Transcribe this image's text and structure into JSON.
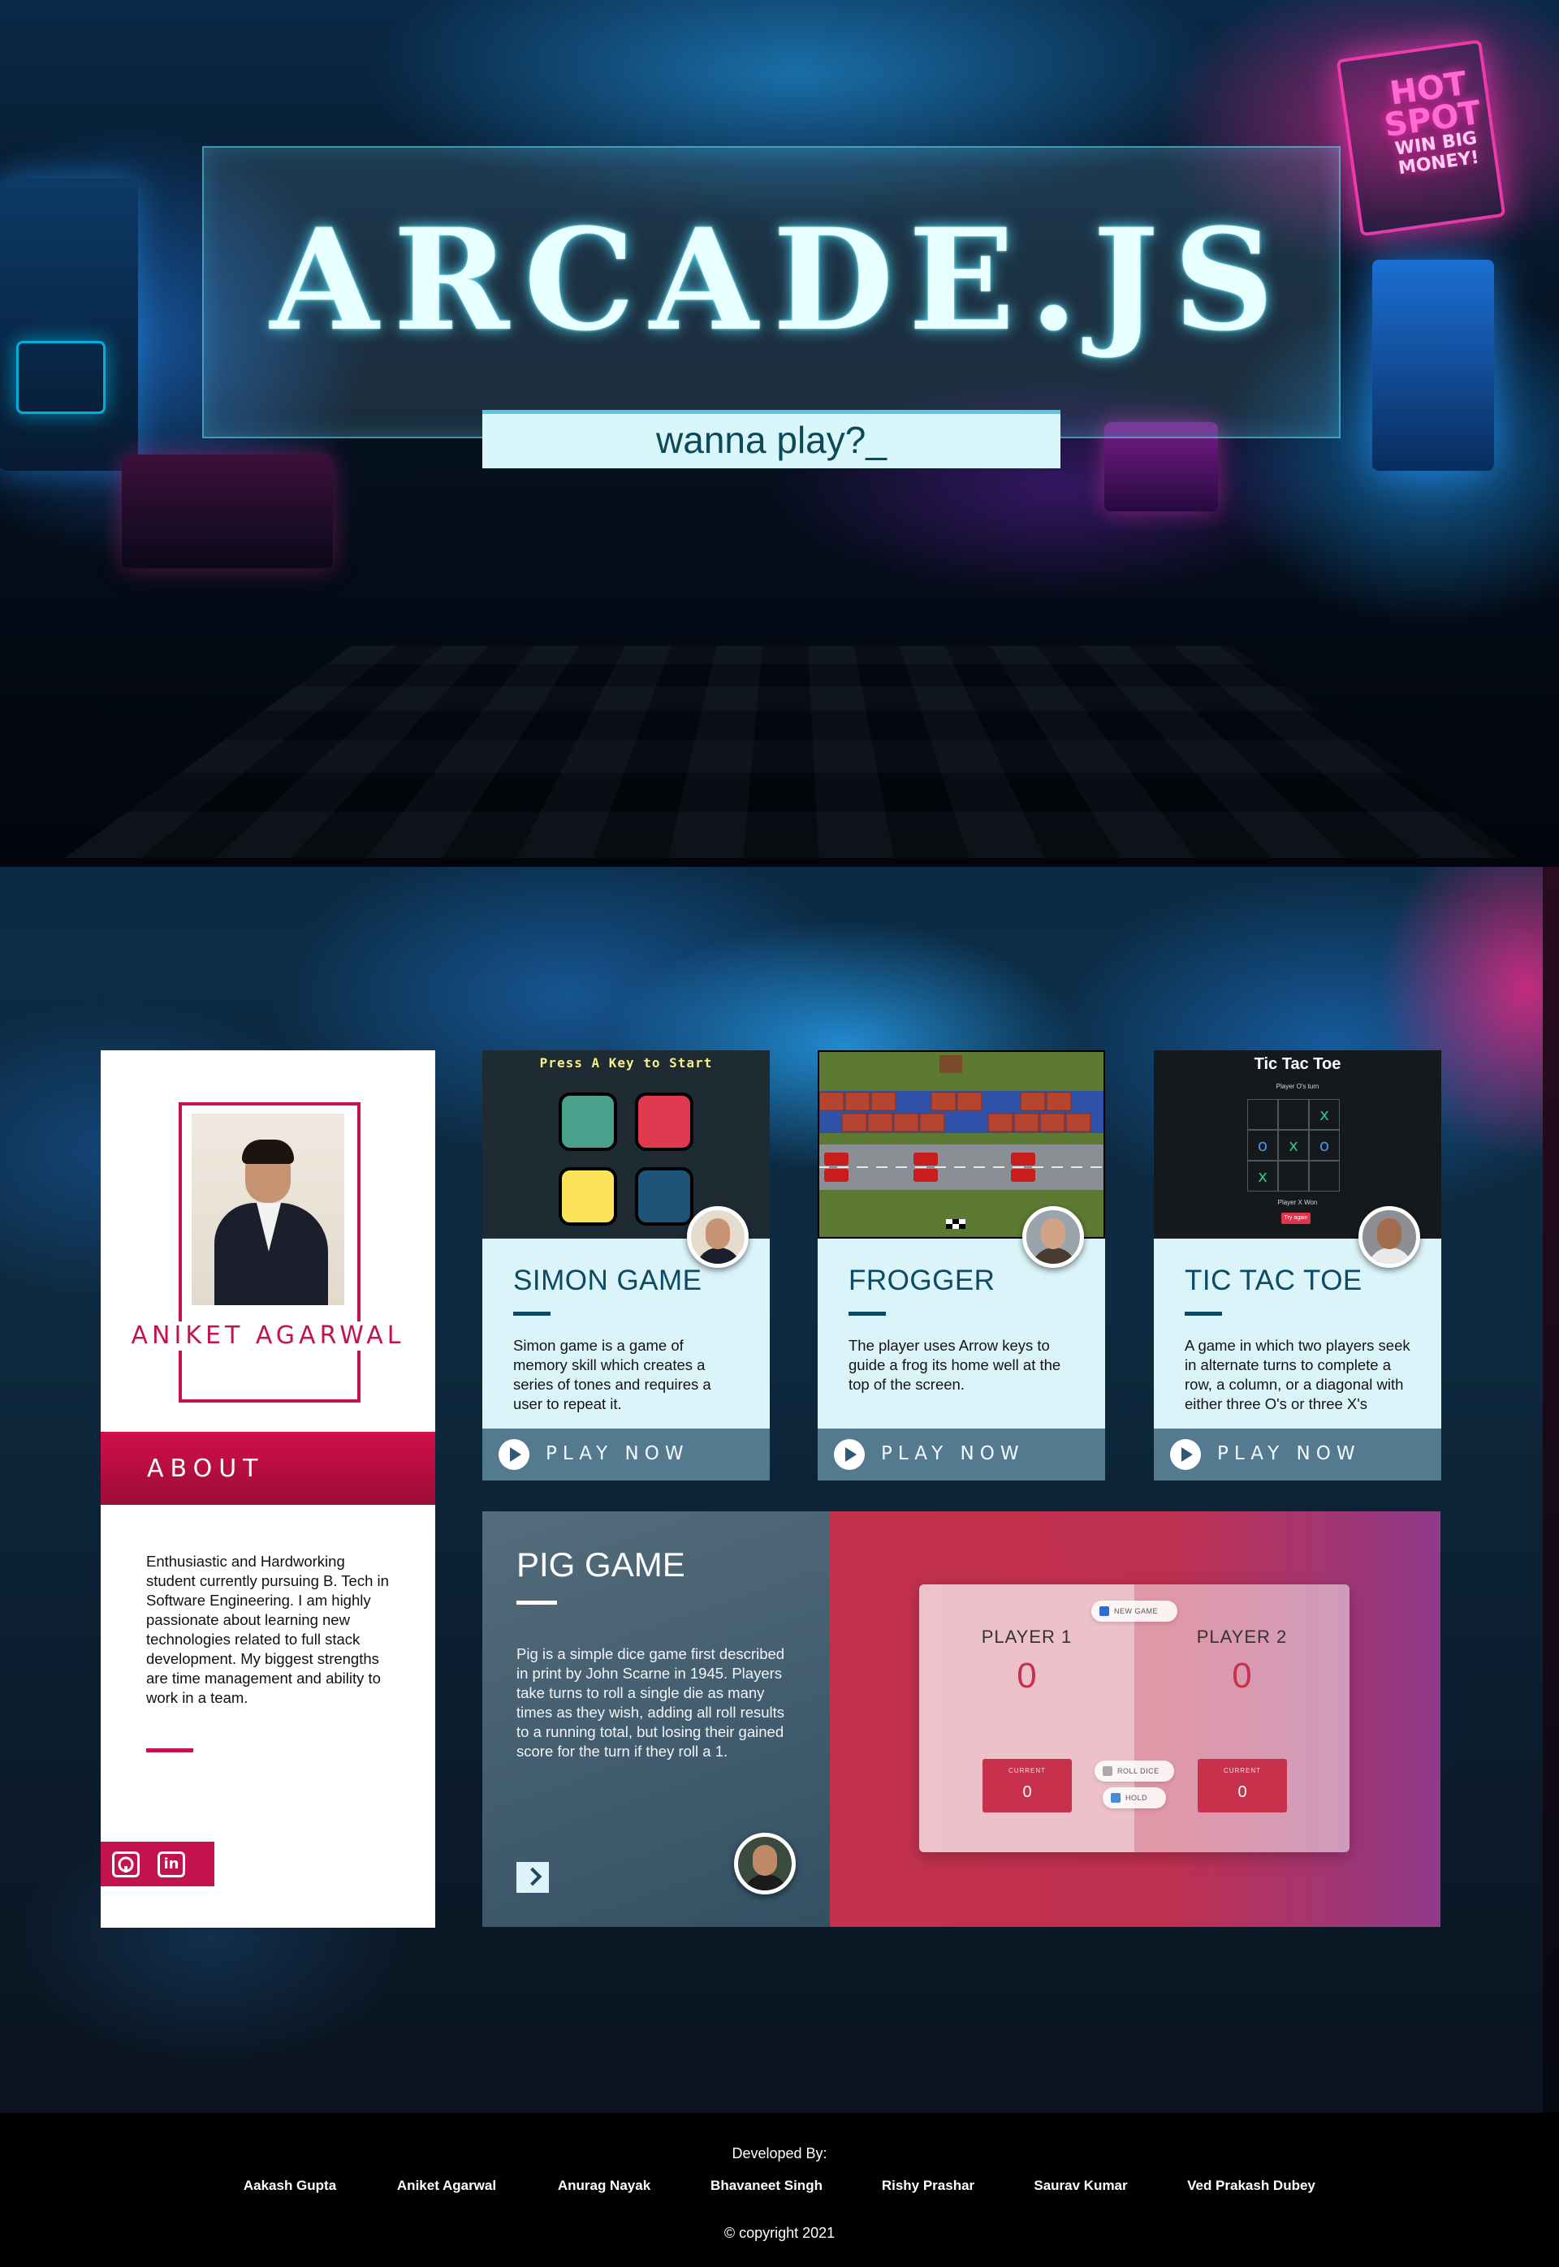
{
  "hero": {
    "title": "ARCADE.JS",
    "tagline": "wanna play?_",
    "sign_hot": "HOT SPOT",
    "sign_win": "WIN BIG MONEY!"
  },
  "profile": {
    "name": "ANIKET AGARWAL",
    "about_heading": "ABOUT",
    "about_text": "Enthusiastic and Hardworking student currently pursuing B. Tech in Software Engineering. I am highly passionate about learning new technologies related to full stack development. My biggest strengths are time management and ability to work in a team.",
    "social": [
      {
        "icon": "github-icon",
        "glyph": "◯"
      },
      {
        "icon": "linkedin-icon",
        "glyph": "in"
      }
    ],
    "accent_color": "#c2134f"
  },
  "games": [
    {
      "title": "SIMON GAME",
      "description": "Simon game is a game of memory skill which creates a series of tones and requires a user to repeat it.",
      "play_label": "PLAY NOW",
      "screenshot_text": "Press A Key to Start"
    },
    {
      "title": "FROGGER",
      "description": "The player uses Arrow keys to guide a frog its home well at the top of the screen.",
      "play_label": "PLAY NOW"
    },
    {
      "title": "TIC TAC TOE",
      "description": "A game in which two players seek in alternate turns to complete a row, a column, or a diagonal with either three O's or three X's",
      "play_label": "PLAY NOW",
      "screenshot_title": "Tic Tac Toe",
      "screenshot_turn": "Player O's turn",
      "screenshot_won": "Player X Won",
      "screenshot_button": "Try again"
    }
  ],
  "pig": {
    "title": "PIG GAME",
    "description": "Pig is a simple dice game first described in print by John Scarne in 1945. Players take turns to roll a single die as many times as they wish, adding all roll results to a running total, but losing their gained score for the turn if they roll a 1.",
    "board": {
      "player1": "PLAYER 1",
      "player2": "PLAYER 2",
      "score1": "0",
      "score2": "0",
      "current_label": "CURRENT",
      "current1": "0",
      "current2": "0",
      "new_game": "NEW GAME",
      "roll_dice": "ROLL DICE",
      "hold": "HOLD"
    }
  },
  "footer": {
    "developed_by": "Developed By:",
    "developers": [
      "Aakash Gupta",
      "Aniket Agarwal",
      "Anurag Nayak",
      "Bhavaneet Singh",
      "Rishy Prashar",
      "Saurav Kumar",
      "Ved Prakash Dubey"
    ],
    "copyright": "© copyright 2021"
  }
}
